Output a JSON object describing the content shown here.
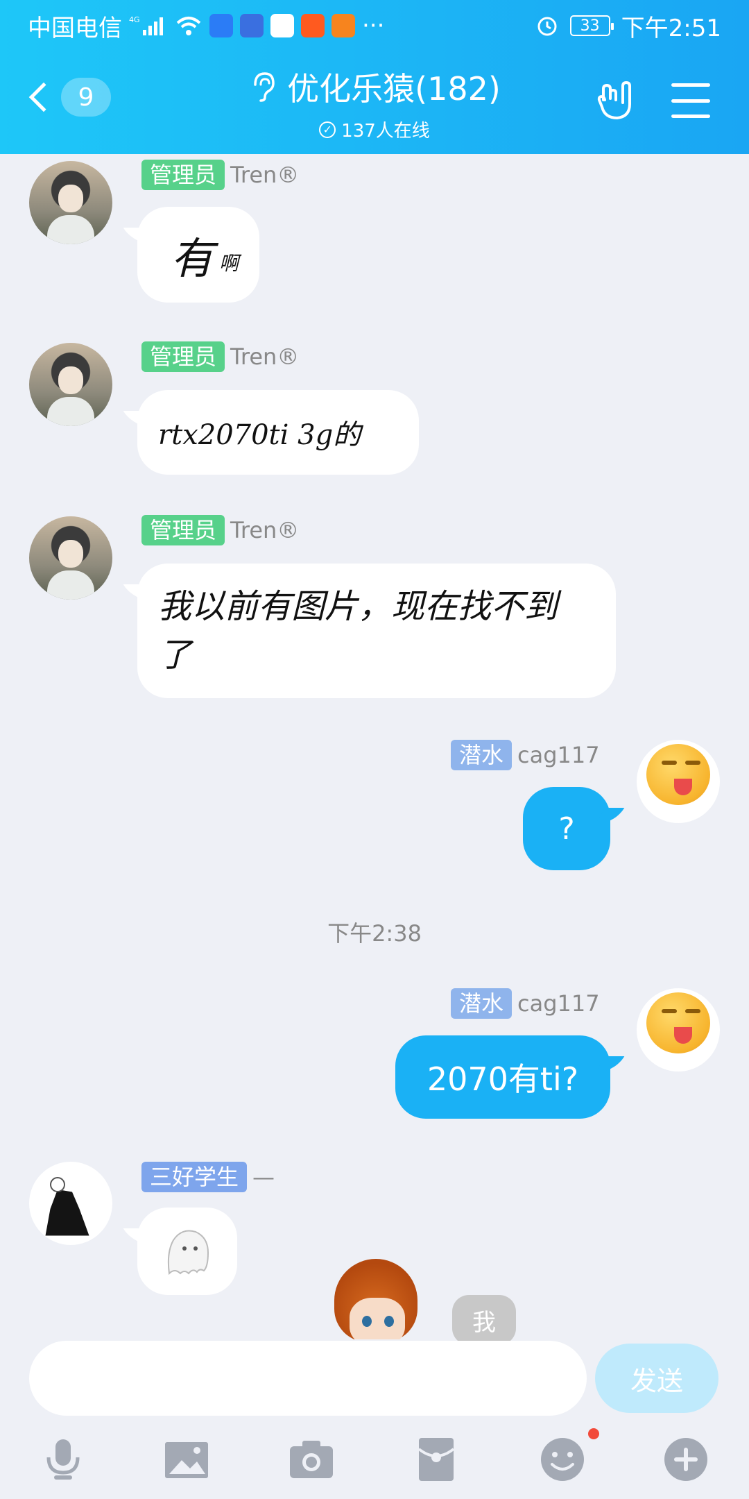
{
  "status_bar": {
    "carrier": "中国电信",
    "network": "4G",
    "battery": "33",
    "time": "下午2:51",
    "more": "···"
  },
  "header": {
    "back_count": "9",
    "title": "优化乐猿(182)",
    "online": "137人在线"
  },
  "messages": [
    {
      "role": "管理员",
      "name": "Tren®",
      "text_big": "有",
      "text_small": "啊"
    },
    {
      "role": "管理员",
      "name": "Tren®",
      "text": "rtx2070ti 3g的"
    },
    {
      "role": "管理员",
      "name": "Tren®",
      "text": "我以前有图片，现在找不到了"
    },
    {
      "role": "潜水",
      "name": "cag117",
      "text": "?"
    },
    {
      "role": "潜水",
      "name": "cag117",
      "text": "2070有ti?"
    },
    {
      "role": "三好学生",
      "name": "—"
    }
  ],
  "time_separator": "下午2:38",
  "sticker_text": "我",
  "input": {
    "placeholder": "",
    "send_label": "发送"
  },
  "colors": {
    "header_start": "#1ec7f8",
    "header_end": "#1aa6f3",
    "own_bubble": "#1ab1f5",
    "admin_badge": "#57d18a",
    "dive_badge": "#8fb4ec"
  }
}
